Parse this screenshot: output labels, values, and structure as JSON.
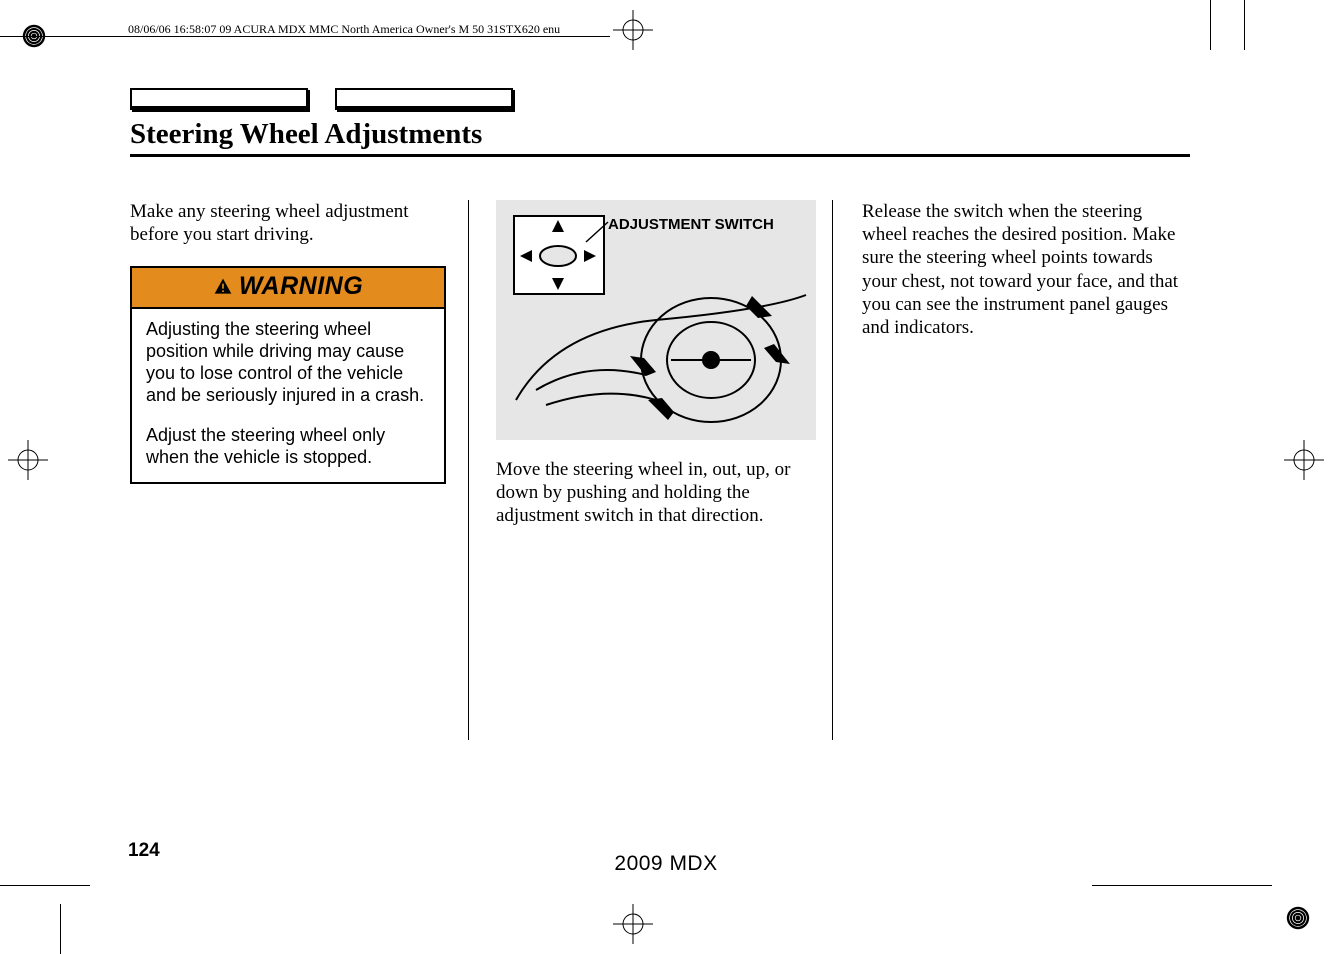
{
  "meta_line": "08/06/06 16:58:07   09 ACURA MDX MMC North America Owner's M 50 31STX620 enu",
  "title": "Steering Wheel Adjustments",
  "col1": {
    "intro": "Make any steering wheel adjustment before you start driving.",
    "warning_label": "WARNING",
    "warning_p1": "Adjusting the steering wheel position while driving may cause you to lose control of the vehicle and be seriously injured in a crash.",
    "warning_p2": "Adjust the steering wheel only when the vehicle is stopped."
  },
  "col2": {
    "diagram_label": "ADJUSTMENT SWITCH",
    "text": "Move the steering wheel in, out, up, or down by pushing and holding the adjustment switch in that direction."
  },
  "col3": {
    "text": "Release the switch when the steering wheel reaches the desired position. Make sure the steering wheel points towards your chest, not toward your face, and that you can see the instrument panel gauges and indicators."
  },
  "page_number": "124",
  "model_year": "2009  MDX"
}
